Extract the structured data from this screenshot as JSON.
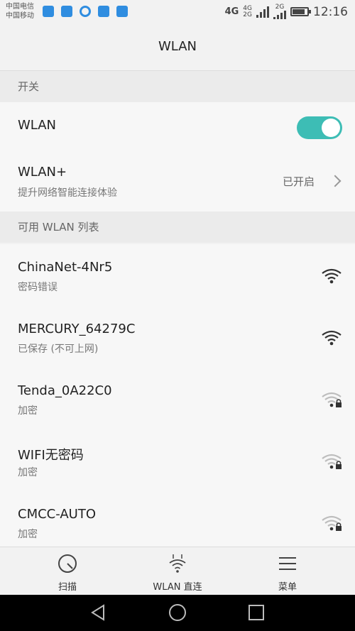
{
  "statusbar": {
    "carrier_line1": "中国电信",
    "carrier_line2": "中国移动",
    "network_4g": "4G",
    "network_4g_small": "4G",
    "network_2g_small": "2G",
    "network_2g_top": "2G",
    "time": "12:16",
    "battery_level": 0.85
  },
  "header": {
    "title": "WLAN"
  },
  "sections": {
    "switch_header": "开关",
    "available_header": "可用 WLAN 列表"
  },
  "wlan_row": {
    "label": "WLAN",
    "toggle_on": true
  },
  "wlan_plus_row": {
    "label": "WLAN+",
    "subtitle": "提升网络智能连接体验",
    "status": "已开启"
  },
  "networks": [
    {
      "ssid": "ChinaNet-4Nr5",
      "status": "密码错误",
      "locked": false,
      "strength": "strong"
    },
    {
      "ssid": "MERCURY_64279C",
      "status": "已保存 (不可上网)",
      "locked": false,
      "strength": "strong"
    },
    {
      "ssid": "Tenda_0A22C0",
      "status": "加密",
      "locked": true,
      "strength": "weak"
    },
    {
      "ssid": "WIFI无密码",
      "status": "加密",
      "locked": true,
      "strength": "weak"
    },
    {
      "ssid": "CMCC-AUTO",
      "status": "加密",
      "locked": true,
      "strength": "weak"
    }
  ],
  "bottom_tabs": [
    {
      "label": "扫描",
      "icon": "scan-icon"
    },
    {
      "label": "WLAN 直连",
      "icon": "wlan-direct-icon"
    },
    {
      "label": "菜单",
      "icon": "menu-icon"
    }
  ],
  "colors": {
    "toggle_on": "#3dbdb5",
    "background": "#f2f2f2"
  }
}
